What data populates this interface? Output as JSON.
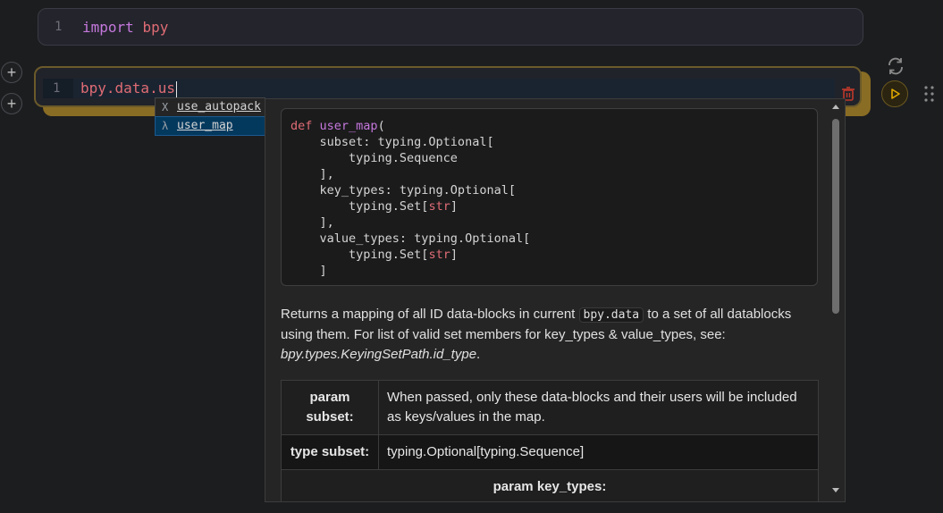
{
  "cell1": {
    "line_number": "1",
    "keyword": "import",
    "module": "bpy"
  },
  "cell2": {
    "line_number": "1",
    "code": "bpy.data.us"
  },
  "add_buttons": [
    "+",
    "+"
  ],
  "suggestions": [
    {
      "kind_icon": "X",
      "label": "use_autopack",
      "selected": false
    },
    {
      "kind_icon": "λ",
      "label": "user_map",
      "selected": true
    }
  ],
  "signature": {
    "def_kw": "def",
    "fn_name": "user_map",
    "lines": [
      "    subset: typing.Optional[",
      "        typing.Sequence",
      "    ],",
      "    key_types: typing.Optional[",
      "        typing.Set[str]",
      "    ],",
      "    value_types: typing.Optional[",
      "        typing.Set[str]",
      "    ]"
    ]
  },
  "description": {
    "part1": "Returns a mapping of all ID data-blocks in current ",
    "code": "bpy.data",
    "part2": " to a set of all datablocks using them. For list of valid set members for key_types & value_types, see: ",
    "ref": "bpy.types.KeyingSetPath.id_type",
    "end": "."
  },
  "params_table": {
    "row1": {
      "head": "param subset:",
      "value": "When passed, only these data-blocks and their users will be included as keys/values in the map."
    },
    "row2": {
      "head": "type subset:",
      "value": "typing.Optional[typing.Sequence]"
    },
    "row3": {
      "head": "param key_types:"
    }
  },
  "colors": {
    "accent": "#8a6d24",
    "keyword": "#c678dd",
    "string": "#e06c75",
    "selection": "#04395e"
  }
}
